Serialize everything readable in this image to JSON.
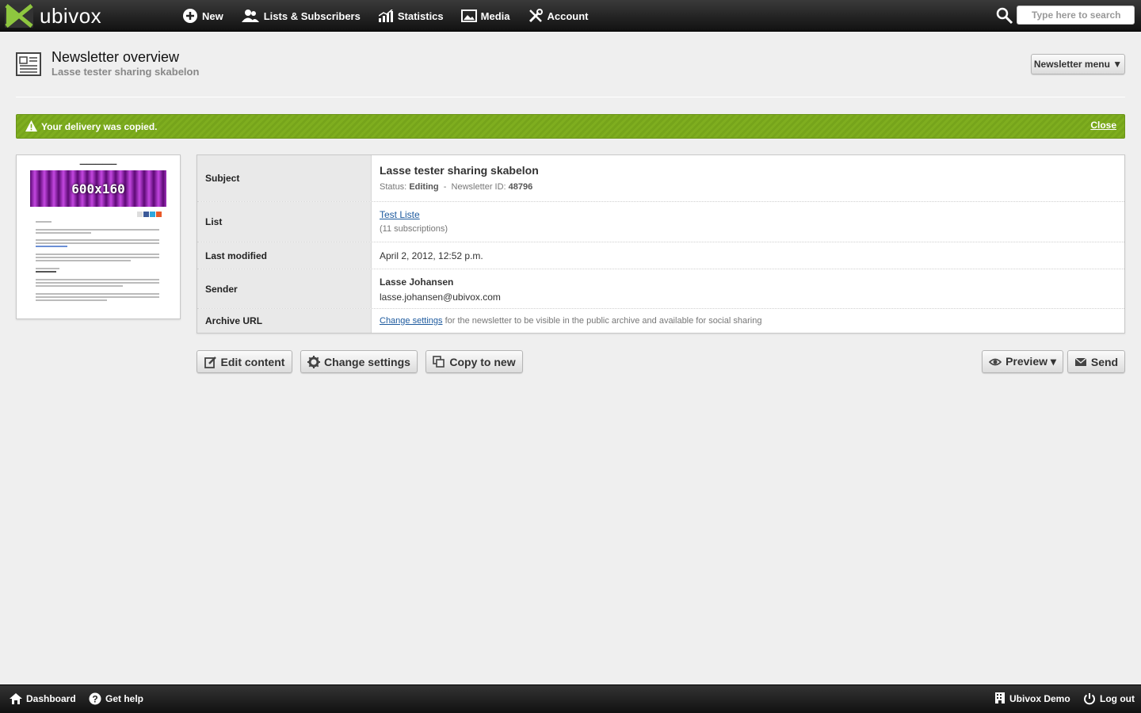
{
  "app": {
    "logo_text": "ubivox"
  },
  "nav": {
    "new": "New",
    "lists": "Lists & Subscribers",
    "statistics": "Statistics",
    "media": "Media",
    "account": "Account"
  },
  "search": {
    "placeholder": "Type here to search"
  },
  "header": {
    "title": "Newsletter overview",
    "subtitle": "Lasse tester sharing skabelon",
    "menu_button": "Newsletter menu ▼"
  },
  "alert": {
    "message": "Your delivery was copied.",
    "close": "Close"
  },
  "thumbnail": {
    "banner_text": "600x160"
  },
  "details": {
    "subject_label": "Subject",
    "subject": "Lasse tester sharing skabelon",
    "status_prefix": "Status:",
    "status": "Editing",
    "separator": "-",
    "id_prefix": "Newsletter ID:",
    "newsletter_id": "48796",
    "list_label": "List",
    "list_name": "Test Liste",
    "list_subs": "(11 subscriptions)",
    "modified_label": "Last modified",
    "modified": "April 2, 2012, 12:52 p.m.",
    "sender_label": "Sender",
    "sender_name": "Lasse Johansen",
    "sender_email": "lasse.johansen@ubivox.com",
    "archive_label": "Archive URL",
    "archive_link": "Change settings",
    "archive_text": "for the newsletter to be visible in the public archive and available for social sharing"
  },
  "actions": {
    "edit": "Edit content",
    "settings": "Change settings",
    "copy": "Copy to new",
    "preview": "Preview ▾",
    "send": "Send"
  },
  "footer": {
    "dashboard": "Dashboard",
    "help": "Get help",
    "account_name": "Ubivox Demo",
    "logout": "Log out"
  },
  "colors": {
    "alert_green": "#7fae1f",
    "link_blue": "#1d5a9e",
    "topbar": "#1a1a1a"
  }
}
